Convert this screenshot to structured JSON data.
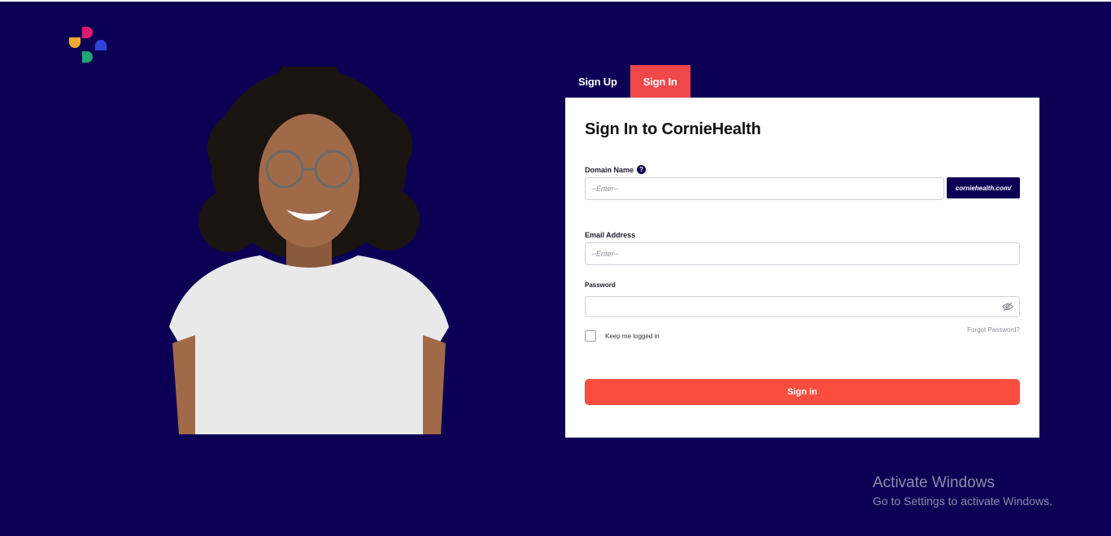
{
  "brand": {
    "logo_icon": "cornie-logo-icon",
    "colors": [
      "#f0a830",
      "#e0196e",
      "#2f45d8",
      "#1fa775"
    ]
  },
  "tabs": [
    {
      "label": "Sign Up",
      "active": false
    },
    {
      "label": "Sign In",
      "active": true
    }
  ],
  "form": {
    "title": "Sign In to CornieHealth",
    "domain": {
      "label": "Domain Name",
      "placeholder": "--Enter--",
      "suffix": "corniehealth.com/",
      "help_icon": "question-circle-icon"
    },
    "email": {
      "label": "Email Address",
      "placeholder": "--Enter--"
    },
    "password": {
      "label": "Password",
      "value": "",
      "toggle_icon": "eye-slash-icon"
    },
    "forgot_label": "Forgot Password?",
    "keep_logged_in": {
      "label": "Keep me logged in",
      "checked": false
    },
    "submit_label": "Sign in"
  },
  "watermark": {
    "title": "Activate Windows",
    "subtitle": "Go to Settings to activate Windows."
  },
  "colors": {
    "background": "#0c0055",
    "accent": "#fa4d3e",
    "tab_active": "#f0474a",
    "card": "#ffffff"
  }
}
